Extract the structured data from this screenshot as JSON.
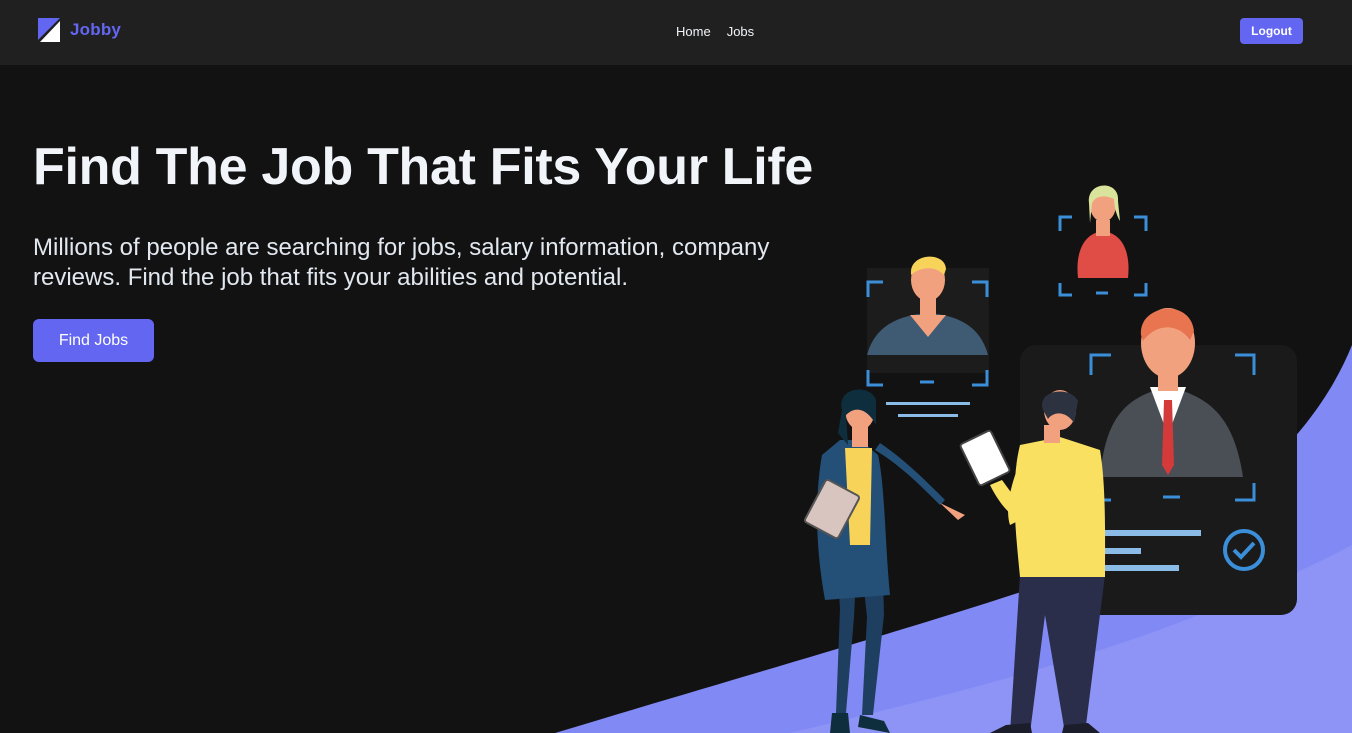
{
  "navbar": {
    "brand_name": "Jobby",
    "logo_icon": "jobby-logo-icon",
    "links": [
      {
        "label": "Home"
      },
      {
        "label": "Jobs"
      }
    ],
    "logout_label": "Logout"
  },
  "hero": {
    "title": "Find The Job That Fits Your Life",
    "description": "Millions of people are searching for jobs, salary information, company reviews. Find the job that fits your abilities and potential.",
    "button_label": "Find Jobs",
    "illustration_icon": "recruitment-illustration"
  },
  "colors": {
    "accent": "#6366f1",
    "background": "#121212",
    "navbar": "#202020",
    "wave": "#8189f5"
  }
}
